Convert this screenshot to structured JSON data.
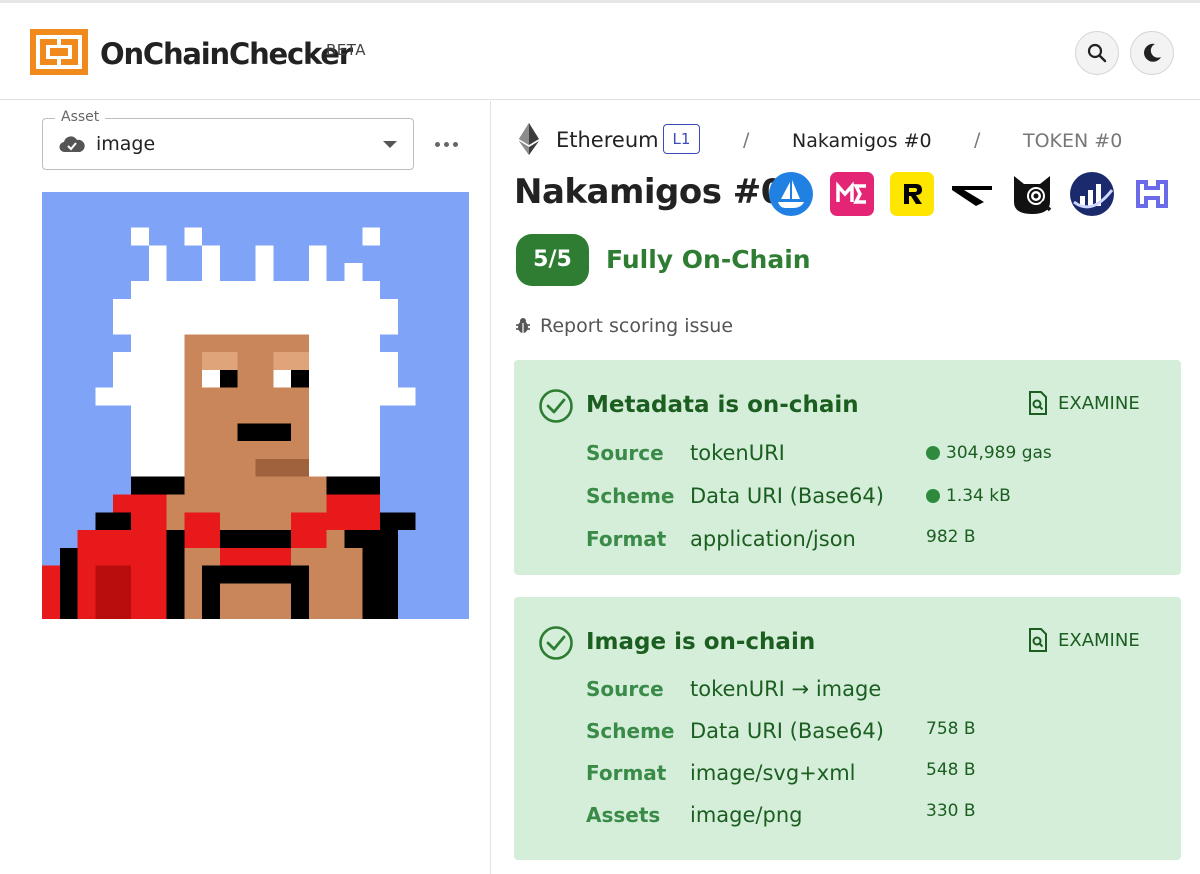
{
  "header": {
    "app_name": "OnChainChecker",
    "badge": "BETA",
    "search_icon": "search-icon",
    "theme_icon": "moon-icon"
  },
  "asset_selector": {
    "label": "Asset",
    "value": "image",
    "icon": "cloud-icon"
  },
  "breadcrumb": {
    "chain": "Ethereum",
    "layer": "L1",
    "separator": "/",
    "collection": "Nakamigos #0",
    "token": "TOKEN #0"
  },
  "token": {
    "title": "Nakamigos #0",
    "marketplaces": [
      "opensea-icon",
      "magic-eden-icon",
      "rarible-icon",
      "x2y2-icon",
      "cat-lens-icon",
      "analytics-icon",
      "chain-link-icon"
    ]
  },
  "score": {
    "value": "5/5",
    "label": "Fully On-Chain",
    "color": "#2e7d32"
  },
  "report_link": "Report scoring issue",
  "cards": [
    {
      "title": "Metadata is on-chain",
      "action": "EXAMINE",
      "rows": [
        {
          "label": "Source",
          "value": "tokenURI",
          "stat": "304,989 gas",
          "dot": true
        },
        {
          "label": "Scheme",
          "value": "Data URI (Base64)",
          "stat": "1.34 kB",
          "dot": true
        },
        {
          "label": "Format",
          "value": "application/json",
          "stat": "982 B",
          "dot": false
        }
      ]
    },
    {
      "title": "Image is on-chain",
      "action": "EXAMINE",
      "rows": [
        {
          "label": "Source",
          "value": "tokenURI → image",
          "stat": "",
          "dot": false
        },
        {
          "label": "Scheme",
          "value": "Data URI (Base64)",
          "stat": "758 B",
          "dot": false
        },
        {
          "label": "Format",
          "value": "image/svg+xml",
          "stat": "548 B",
          "dot": false
        },
        {
          "label": "Assets",
          "value": "image/png",
          "stat": "330 B",
          "dot": false
        }
      ]
    }
  ],
  "colors": {
    "brand_orange": "#f08a1c",
    "success_green": "#2e7d32",
    "card_bg": "#d5eeda",
    "image_bg": "#7fa4f7"
  }
}
